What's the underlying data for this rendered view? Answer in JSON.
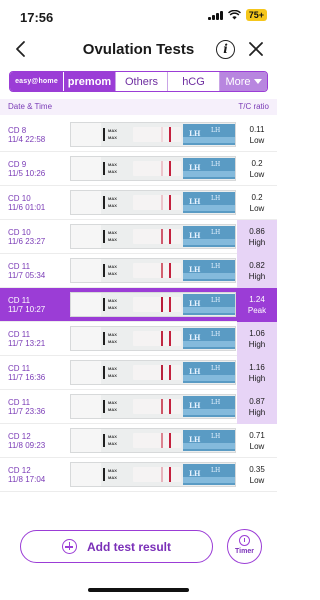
{
  "status_bar": {
    "time": "17:56",
    "battery": "75+"
  },
  "header": {
    "title": "Ovulation Tests"
  },
  "tabs": [
    {
      "label": "easy@home"
    },
    {
      "label": "premom"
    },
    {
      "label": "Others"
    },
    {
      "label": "hCG"
    },
    {
      "label": "More"
    }
  ],
  "columns": {
    "date": "Date & Time",
    "ratio": "T/C ratio"
  },
  "strip_text": {
    "max": "MAX",
    "lh": "LH",
    "brand": "easy@home"
  },
  "rows": [
    {
      "cd": "CD 8",
      "datetime": "11/4 22:58",
      "ratio": "0.11",
      "level": "Low",
      "t_line_color": "#f1d7db"
    },
    {
      "cd": "CD 9",
      "datetime": "11/5 10:26",
      "ratio": "0.2",
      "level": "Low",
      "t_line_color": "#ecc4cb"
    },
    {
      "cd": "CD 10",
      "datetime": "11/6 01:01",
      "ratio": "0.2",
      "level": "Low",
      "t_line_color": "#ecc4cb"
    },
    {
      "cd": "CD 10",
      "datetime": "11/6 23:27",
      "ratio": "0.86",
      "level": "High",
      "t_line_color": "#cf5a6e"
    },
    {
      "cd": "CD 11",
      "datetime": "11/7 05:34",
      "ratio": "0.82",
      "level": "High",
      "t_line_color": "#d2606f"
    },
    {
      "cd": "CD 11",
      "datetime": "11/7 10:27",
      "ratio": "1.24",
      "level": "Peak",
      "t_line_color": "#b81c3a"
    },
    {
      "cd": "CD 11",
      "datetime": "11/7 13:21",
      "ratio": "1.06",
      "level": "High",
      "t_line_color": "#bf2842"
    },
    {
      "cd": "CD 11",
      "datetime": "11/7 16:36",
      "ratio": "1.16",
      "level": "High",
      "t_line_color": "#b8223d"
    },
    {
      "cd": "CD 11",
      "datetime": "11/7 23:36",
      "ratio": "0.87",
      "level": "High",
      "t_line_color": "#cd5566"
    },
    {
      "cd": "CD 12",
      "datetime": "11/8 09:23",
      "ratio": "0.71",
      "level": "Low",
      "t_line_color": "#dc8390"
    },
    {
      "cd": "CD 12",
      "datetime": "11/8 17:04",
      "ratio": "0.35",
      "level": "Low",
      "t_line_color": "#e7b3bc"
    }
  ],
  "actions": {
    "add_label": "Add test result",
    "timer_label": "Timer"
  },
  "colors": {
    "accent": "#9b3dd6",
    "high_bg": "#e7d4f6",
    "control_line": "#c4203d"
  }
}
